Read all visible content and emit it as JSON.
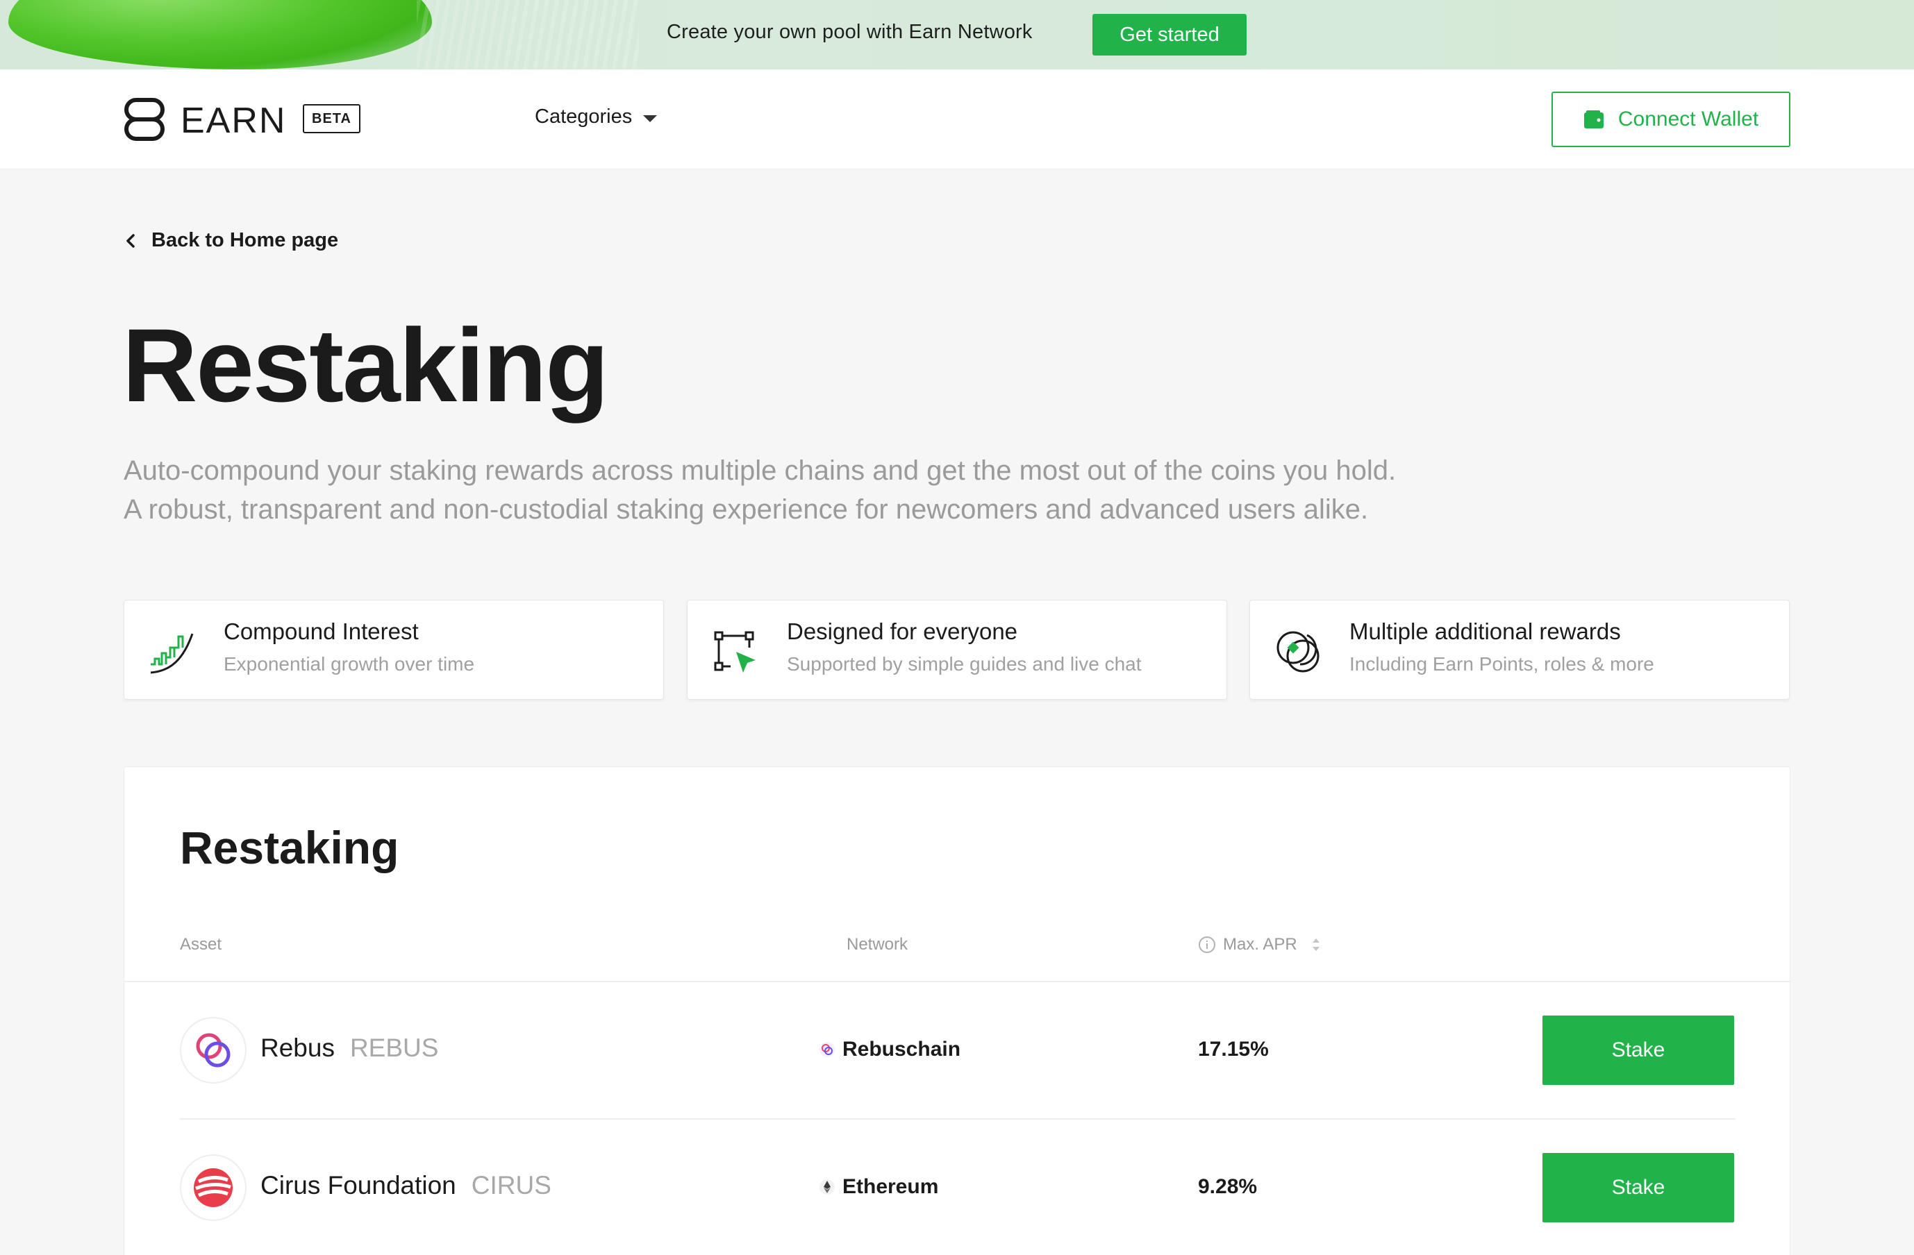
{
  "promo": {
    "text": "Create your own pool with Earn Network",
    "cta": "Get started"
  },
  "header": {
    "brand": "EARN",
    "badge": "BETA",
    "categories": "Categories",
    "connect_wallet": "Connect Wallet"
  },
  "page": {
    "back_link": "Back to Home page",
    "title": "Restaking",
    "subtitle_line1": "Auto-compound your staking rewards across multiple chains and get the most out of the coins you hold.",
    "subtitle_line2": "A robust, transparent and non-custodial staking experience for newcomers and advanced users alike."
  },
  "features": [
    {
      "title": "Compound Interest",
      "description": "Exponential growth over time",
      "icon": "growth-chart-icon"
    },
    {
      "title": "Designed for everyone",
      "description": "Supported by simple guides and live chat",
      "icon": "cursor-select-icon"
    },
    {
      "title": "Multiple additional rewards",
      "description": "Including Earn Points, roles & more",
      "icon": "coins-icon"
    }
  ],
  "table": {
    "title": "Restaking",
    "columns": {
      "asset": "Asset",
      "network": "Network",
      "apr": "Max. APR"
    },
    "rows": [
      {
        "name": "Rebus",
        "ticker": "REBUS",
        "network": "Rebuschain",
        "apr": "17.15%",
        "action": "Stake",
        "logo": "rebus-logo-icon",
        "network_icon": "rebuschain-icon"
      },
      {
        "name": "Cirus Foundation",
        "ticker": "CIRUS",
        "network": "Ethereum",
        "apr": "9.28%",
        "action": "Stake",
        "logo": "cirus-logo-icon",
        "network_icon": "ethereum-icon"
      }
    ]
  },
  "colors": {
    "accent": "#21b34a",
    "banner_bg": "#d6e9d8",
    "page_bg": "#f6f6f6",
    "muted_text": "#9a9a9a"
  }
}
